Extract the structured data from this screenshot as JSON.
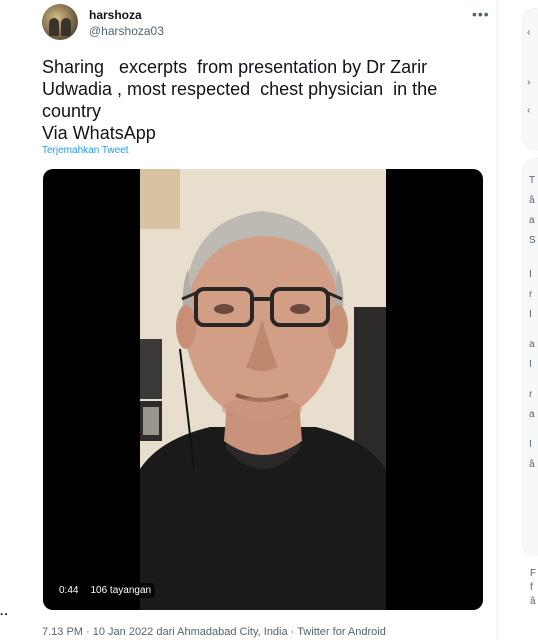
{
  "tweet": {
    "display_name": "harshoza",
    "handle": "@harshoza03",
    "more_icon": "more-horizontal-icon",
    "text": "Sharing   excerpts  from presentation by Dr Zarir\nUdwadia , most respected  chest physician  in the\ncountry\nVia WhatsApp",
    "translate_label": "Terjemahkan Tweet",
    "video": {
      "elapsed": "0:44",
      "views": "106 tayangan"
    },
    "timestamp": "7.13 PM · 10 Jan 2022 dari Ahmadabad City, India · Twitter for Android"
  },
  "left_ellipsis": "..",
  "right_sidebar_snippets": [
    "T",
    "â",
    "a",
    "S",
    "I",
    "r",
    "I",
    "a",
    "I",
    "r",
    "a",
    "I",
    "â",
    "F",
    "f",
    "â"
  ]
}
